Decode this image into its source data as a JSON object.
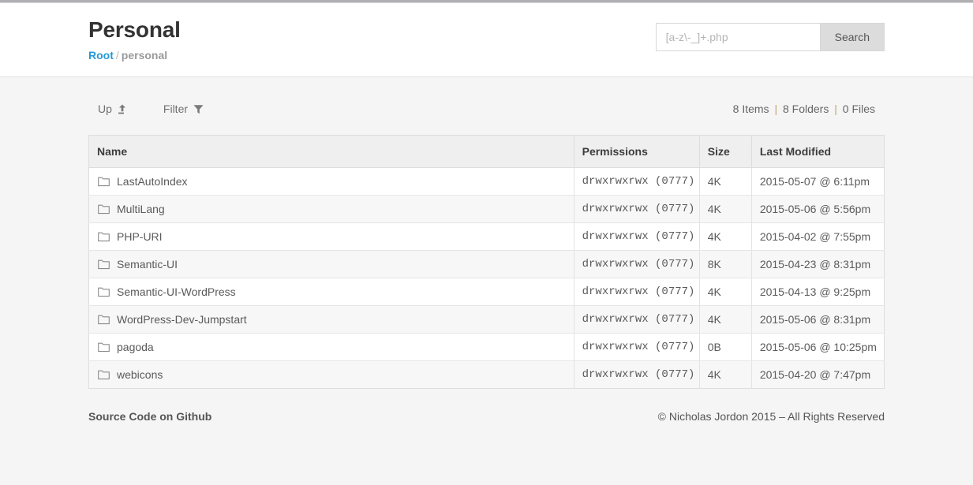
{
  "header": {
    "title": "Personal",
    "breadcrumb": {
      "root_label": "Root",
      "separator": "/",
      "current_label": "personal"
    }
  },
  "search": {
    "placeholder": "[a-z\\-_]+.php",
    "value": "",
    "button_label": "Search"
  },
  "toolbar": {
    "up_label": "Up",
    "up_icon": "arrow-up-to-line-icon",
    "filter_label": "Filter",
    "filter_icon": "funnel-icon",
    "counts": {
      "items": "8 Items",
      "sep1": "|",
      "folders": "8 Folders",
      "sep2": "|",
      "files": "0 Files"
    }
  },
  "table": {
    "columns": [
      "Name",
      "Permissions",
      "Size",
      "Last Modified"
    ],
    "rows": [
      {
        "icon": "folder-icon",
        "name": "LastAutoIndex",
        "permissions": "drwxrwxrwx (0777)",
        "size": "4K",
        "modified": "2015-05-07 @ 6:11pm"
      },
      {
        "icon": "folder-icon",
        "name": "MultiLang",
        "permissions": "drwxrwxrwx (0777)",
        "size": "4K",
        "modified": "2015-05-06 @ 5:56pm"
      },
      {
        "icon": "folder-icon",
        "name": "PHP-URI",
        "permissions": "drwxrwxrwx (0777)",
        "size": "4K",
        "modified": "2015-04-02 @ 7:55pm"
      },
      {
        "icon": "folder-icon",
        "name": "Semantic-UI",
        "permissions": "drwxrwxrwx (0777)",
        "size": "8K",
        "modified": "2015-04-23 @ 8:31pm"
      },
      {
        "icon": "folder-icon",
        "name": "Semantic-UI-WordPress",
        "permissions": "drwxrwxrwx (0777)",
        "size": "4K",
        "modified": "2015-04-13 @ 9:25pm"
      },
      {
        "icon": "folder-icon",
        "name": "WordPress-Dev-Jumpstart",
        "permissions": "drwxrwxrwx (0777)",
        "size": "4K",
        "modified": "2015-05-06 @ 8:31pm"
      },
      {
        "icon": "folder-icon",
        "name": "pagoda",
        "permissions": "drwxrwxrwx (0777)",
        "size": "0B",
        "modified": "2015-05-06 @ 10:25pm"
      },
      {
        "icon": "folder-icon",
        "name": "webicons",
        "permissions": "drwxrwxrwx (0777)",
        "size": "4K",
        "modified": "2015-04-20 @ 7:47pm"
      }
    ]
  },
  "footer": {
    "source_link": "Source Code on Github",
    "copyright": "© Nicholas Jordon 2015 – All Rights Reserved"
  },
  "colors": {
    "link_blue": "#2698d8",
    "page_background": "#f5f5f5",
    "header_background": "#ffffff",
    "table_header_background": "#efefef",
    "row_alt_background": "#f7f7f7",
    "search_button_background": "#dcdcdc"
  }
}
